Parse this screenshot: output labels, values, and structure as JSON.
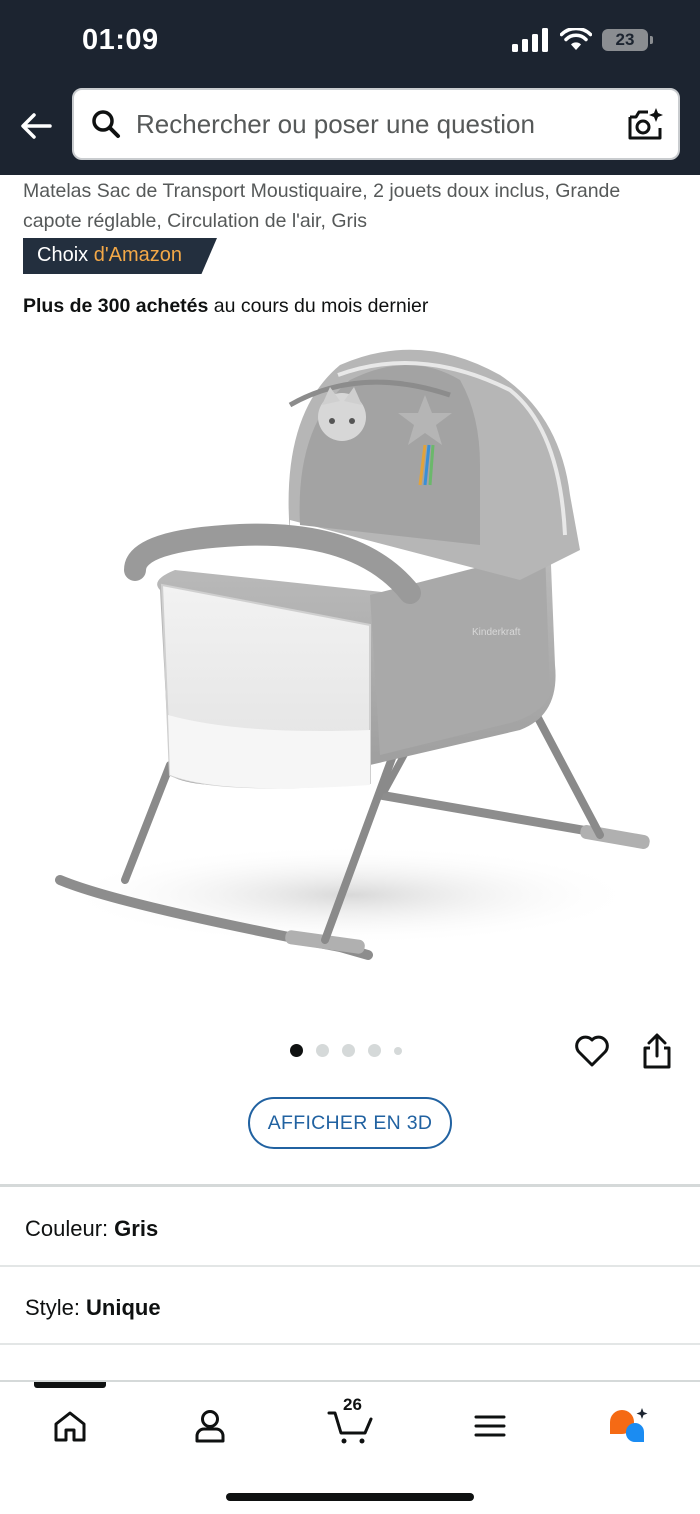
{
  "status_bar": {
    "time": "01:09",
    "battery": "23"
  },
  "search": {
    "placeholder": "Rechercher ou poser une question"
  },
  "product": {
    "title": "Matelas Sac de Transport Moustiquaire, 2 jouets doux inclus, Grande capote réglable, Circulation de l'air, Gris",
    "badge_prefix": "Choix",
    "badge_brand": "d'Amazon",
    "purchases_bold": "Plus de 300 achetés",
    "purchases_rest": "au cours du mois dernier",
    "image_count": 5,
    "active_image": 1
  },
  "actions": {
    "view_3d": "AFFICHER EN 3D"
  },
  "variations": {
    "color_label": "Couleur:",
    "color_value": "Gris",
    "style_label": "Style:",
    "style_value": "Unique"
  },
  "bottom_nav": {
    "items": [
      "home-icon",
      "account-icon",
      "cart-icon",
      "menu-icon",
      "rufus-icon"
    ],
    "cart_count": "26"
  },
  "colors": {
    "header_bg": "#1c2430",
    "badge_bg": "#232f3e",
    "badge_accent": "#f3a847",
    "link_blue": "#2162a1",
    "rufus_orange": "#f56a14",
    "rufus_blue": "#1b8cf2"
  }
}
